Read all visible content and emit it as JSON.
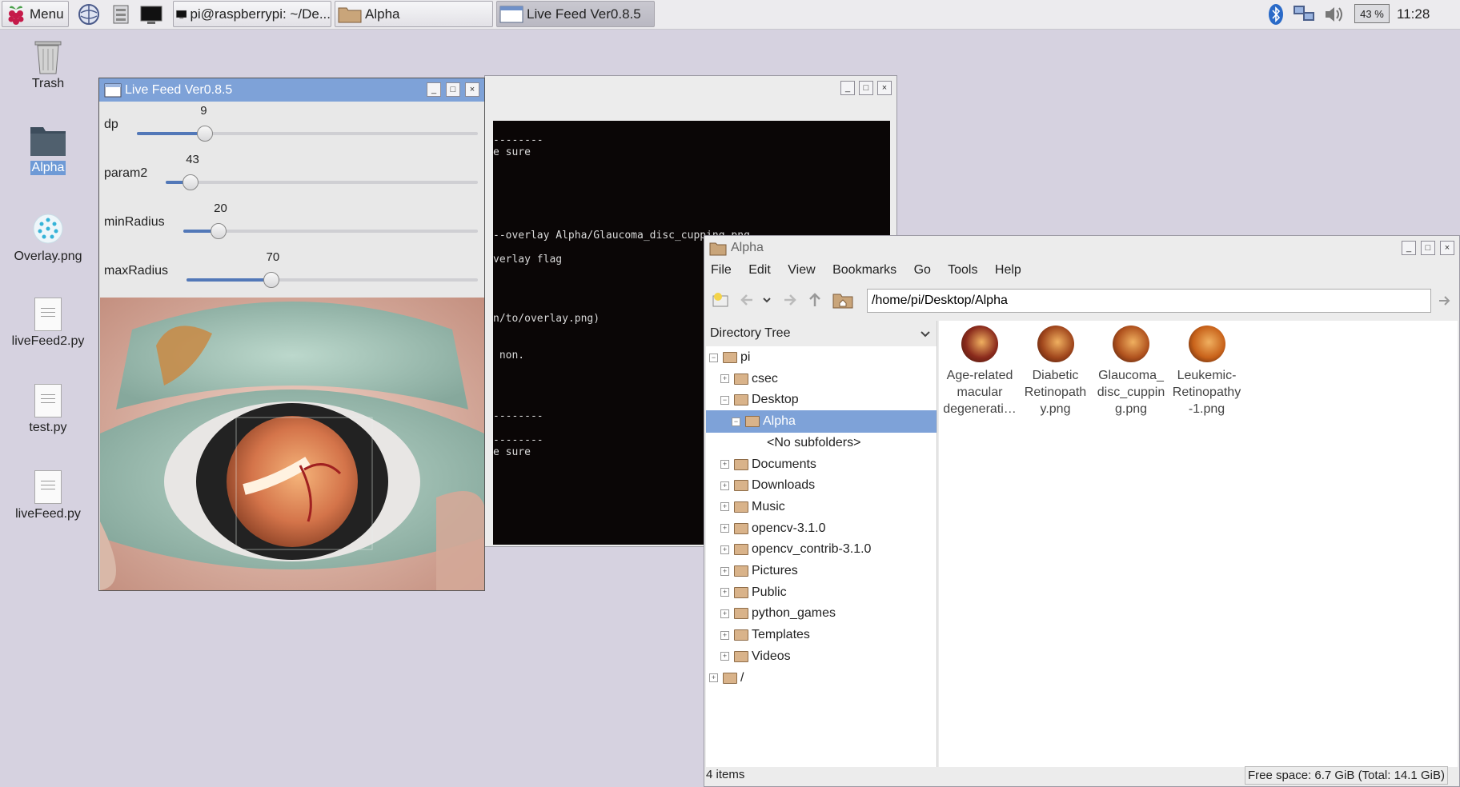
{
  "taskbar": {
    "menu_label": "Menu",
    "tasks": [
      {
        "label": "pi@raspberrypi: ~/De..."
      },
      {
        "label": "Alpha"
      },
      {
        "label": "Live Feed Ver0.8.5"
      }
    ],
    "battery": "43 %",
    "clock": "11:28"
  },
  "desktop": {
    "icons": [
      {
        "label": "Trash"
      },
      {
        "label": "Alpha"
      },
      {
        "label": "Overlay.png"
      },
      {
        "label": "liveFeed2.py"
      },
      {
        "label": "test.py"
      },
      {
        "label": "liveFeed.py"
      }
    ]
  },
  "terminal": {
    "lines": [
      "--------",
      "e sure",
      "--overlay Alpha/Glaucoma_disc_cupping.png",
      "verlay flag",
      "n/to/overlay.png)",
      " non.",
      "--------",
      "--------",
      "e sure"
    ]
  },
  "livefeed": {
    "title": "Live Feed Ver0.8.5",
    "sliders": [
      {
        "label": "dp",
        "value": "9",
        "fraction": 0.2
      },
      {
        "label": "param2",
        "value": "43",
        "fraction": 0.08
      },
      {
        "label": "minRadius",
        "value": "20",
        "fraction": 0.12
      },
      {
        "label": "maxRadius",
        "value": "70",
        "fraction": 0.29
      }
    ]
  },
  "filemanager": {
    "title": "Alpha",
    "menu": [
      "File",
      "Edit",
      "View",
      "Bookmarks",
      "Go",
      "Tools",
      "Help"
    ],
    "path": "/home/pi/Desktop/Alpha",
    "tree_header": "Directory Tree",
    "tree": [
      {
        "label": "pi",
        "level": 0,
        "expander": "−"
      },
      {
        "label": "csec",
        "level": 1,
        "expander": "+"
      },
      {
        "label": "Desktop",
        "level": 1,
        "expander": "−"
      },
      {
        "label": "Alpha",
        "level": 2,
        "expander": "−",
        "selected": true
      },
      {
        "label": "<No subfolders>",
        "level": 3,
        "expander": ""
      },
      {
        "label": "Documents",
        "level": 1,
        "expander": "+"
      },
      {
        "label": "Downloads",
        "level": 1,
        "expander": "+"
      },
      {
        "label": "Music",
        "level": 1,
        "expander": "+"
      },
      {
        "label": "opencv-3.1.0",
        "level": 1,
        "expander": "+"
      },
      {
        "label": "opencv_contrib-3.1.0",
        "level": 1,
        "expander": "+"
      },
      {
        "label": "Pictures",
        "level": 1,
        "expander": "+"
      },
      {
        "label": "Public",
        "level": 1,
        "expander": "+"
      },
      {
        "label": "python_games",
        "level": 1,
        "expander": "+"
      },
      {
        "label": "Templates",
        "level": 1,
        "expander": "+"
      },
      {
        "label": "Videos",
        "level": 1,
        "expander": "+"
      },
      {
        "label": "/",
        "level": 0,
        "expander": "+"
      }
    ],
    "files": [
      {
        "lines": [
          "Age-related",
          "macular",
          "degenerati…"
        ],
        "color": "#8a2a1c"
      },
      {
        "lines": [
          "Diabetic",
          "Retinopath",
          "y.png"
        ],
        "color": "#a0461c"
      },
      {
        "lines": [
          "Glaucoma_",
          "disc_cuppin",
          "g.png"
        ],
        "color": "#b0521e"
      },
      {
        "lines": [
          "Leukemic-",
          "Retinopathy",
          "-1.png"
        ],
        "color": "#c8621a"
      }
    ],
    "status_left": "4 items",
    "status_right": "Free space: 6.7 GiB (Total: 14.1 GiB)"
  }
}
